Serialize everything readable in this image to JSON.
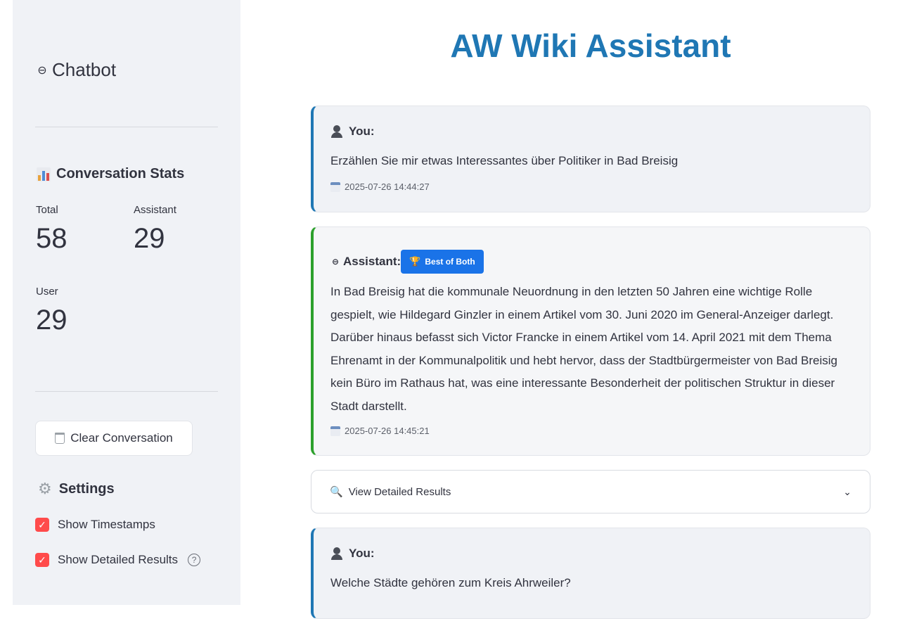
{
  "sidebar": {
    "title": "Chatbot",
    "stats_title": "Conversation Stats",
    "metrics": [
      {
        "label": "Total",
        "value": "58"
      },
      {
        "label": "Assistant",
        "value": "29"
      },
      {
        "label": "User",
        "value": "29"
      }
    ],
    "clear_label": "Clear Conversation",
    "settings_title": "Settings",
    "options": [
      {
        "label": "Show Timestamps",
        "checked": true
      },
      {
        "label": "Show Detailed Results",
        "checked": true
      }
    ],
    "checkbox_mark": "✓",
    "help_mark": "?"
  },
  "main": {
    "title": "AW Wiki Assistant",
    "messages": [
      {
        "role": "You:",
        "text": "Erzählen Sie mir etwas Interessantes über Politiker in Bad Breisig",
        "timestamp": "2025-07-26 14:44:27"
      },
      {
        "role": "Assistant:",
        "badge": "Best of Both",
        "text": "In Bad Breisig hat die kommunale Neuordnung in den letzten 50 Jahren eine wichtige Rolle gespielt, wie Hildegard Ginzler in einem Artikel vom 30. Juni 2020 im General-Anzeiger darlegt. Darüber hinaus befasst sich Victor Francke in einem Artikel vom 14. April 2021 mit dem Thema Ehrenamt in der Kommunalpolitik und hebt hervor, dass der Stadtbürgermeister von Bad Breisig kein Büro im Rathaus hat, was eine interessante Besonderheit der politischen Struktur in dieser Stadt darstellt.",
        "timestamp": "2025-07-26 14:45:21"
      },
      {
        "role": "You:",
        "text": "Welche Städte gehören zum Kreis Ahrweiler?"
      }
    ],
    "expander_label": "View Detailed Results"
  },
  "colors": {
    "title_blue": "#1f77b4",
    "user_border": "#1f77b4",
    "assistant_border": "#2ca02c",
    "checkbox_red": "#ff4b4b",
    "badge_blue": "#1a73e8"
  },
  "icons": [
    "robot-icon",
    "bar-chart-icon",
    "trash-icon",
    "gear-icon",
    "checkbox-icon",
    "help-icon",
    "user-icon",
    "calendar-icon",
    "trophy-icon",
    "search-icon",
    "chevron-down-icon"
  ]
}
